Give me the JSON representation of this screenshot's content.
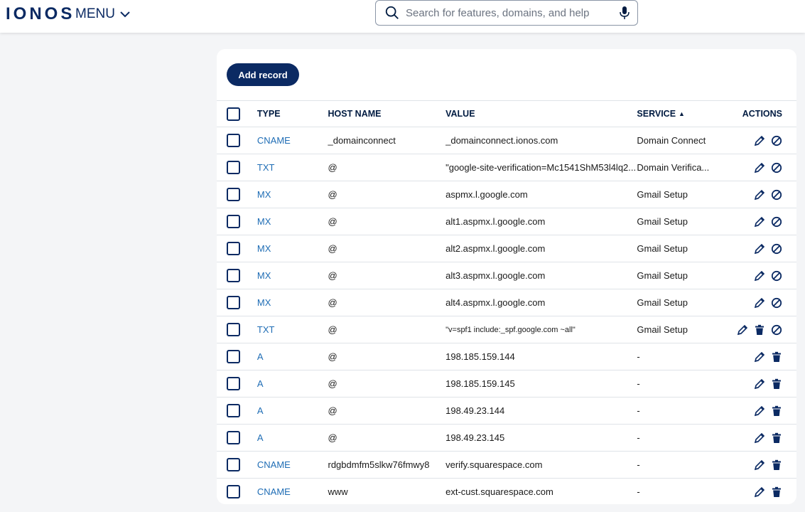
{
  "header": {
    "logo": "IONOS",
    "menu_label": "MENU",
    "search_placeholder": "Search for features, domains, and help"
  },
  "toolbar": {
    "add_record_label": "Add record"
  },
  "table": {
    "columns": {
      "type": "TYPE",
      "host": "HOST NAME",
      "value": "VALUE",
      "service": "SERVICE",
      "actions": "ACTIONS"
    },
    "sort_indicator": "▲",
    "rows": [
      {
        "type": "CNAME",
        "host": "_domainconnect",
        "value": "_domainconnect.ionos.com",
        "service": "Domain Connect",
        "actions": [
          "edit",
          "disable"
        ]
      },
      {
        "type": "TXT",
        "host": "@",
        "value": "\"google-site-verification=Mc1541ShM53l4lq2...",
        "service": "Domain Verifica...",
        "actions": [
          "edit",
          "disable"
        ]
      },
      {
        "type": "MX",
        "host": "@",
        "value": "aspmx.l.google.com",
        "service": "Gmail Setup",
        "actions": [
          "edit",
          "disable"
        ]
      },
      {
        "type": "MX",
        "host": "@",
        "value": "alt1.aspmx.l.google.com",
        "service": "Gmail Setup",
        "actions": [
          "edit",
          "disable"
        ]
      },
      {
        "type": "MX",
        "host": "@",
        "value": "alt2.aspmx.l.google.com",
        "service": "Gmail Setup",
        "actions": [
          "edit",
          "disable"
        ]
      },
      {
        "type": "MX",
        "host": "@",
        "value": "alt3.aspmx.l.google.com",
        "service": "Gmail Setup",
        "actions": [
          "edit",
          "disable"
        ]
      },
      {
        "type": "MX",
        "host": "@",
        "value": "alt4.aspmx.l.google.com",
        "service": "Gmail Setup",
        "actions": [
          "edit",
          "disable"
        ]
      },
      {
        "type": "TXT",
        "host": "@",
        "value": "\"v=spf1 include:_spf.google.com ~all\"",
        "service": "Gmail Setup",
        "actions": [
          "edit",
          "delete",
          "disable"
        ],
        "small_value": true
      },
      {
        "type": "A",
        "host": "@",
        "value": "198.185.159.144",
        "service": "-",
        "actions": [
          "edit",
          "delete"
        ]
      },
      {
        "type": "A",
        "host": "@",
        "value": "198.185.159.145",
        "service": "-",
        "actions": [
          "edit",
          "delete"
        ]
      },
      {
        "type": "A",
        "host": "@",
        "value": "198.49.23.144",
        "service": "-",
        "actions": [
          "edit",
          "delete"
        ]
      },
      {
        "type": "A",
        "host": "@",
        "value": "198.49.23.145",
        "service": "-",
        "actions": [
          "edit",
          "delete"
        ]
      },
      {
        "type": "CNAME",
        "host": "rdgbdmfm5slkw76fmwy8",
        "value": "verify.squarespace.com",
        "service": "-",
        "actions": [
          "edit",
          "delete"
        ]
      },
      {
        "type": "CNAME",
        "host": "www",
        "value": "ext-cust.squarespace.com",
        "service": "-",
        "actions": [
          "edit",
          "delete"
        ]
      }
    ]
  },
  "colors": {
    "brand": "#0b2a63",
    "link": "#1f6db5",
    "background": "#f4f5f7"
  },
  "icons": {
    "edit": "pencil-icon",
    "delete": "trash-icon",
    "disable": "disable-icon"
  }
}
